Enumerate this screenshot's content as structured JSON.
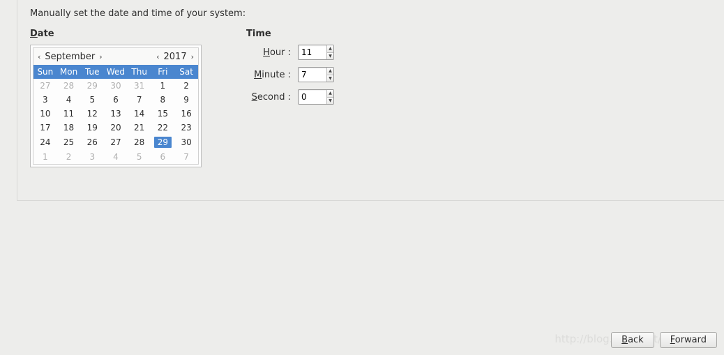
{
  "instruction": "Manually set the date and time of your system:",
  "date": {
    "title_prefix": "D",
    "title_rest": "ate",
    "month": "September",
    "year": "2017",
    "weekdays": [
      "Sun",
      "Mon",
      "Tue",
      "Wed",
      "Thu",
      "Fri",
      "Sat"
    ],
    "weeks": [
      [
        {
          "d": "27",
          "o": true
        },
        {
          "d": "28",
          "o": true
        },
        {
          "d": "29",
          "o": true
        },
        {
          "d": "30",
          "o": true
        },
        {
          "d": "31",
          "o": true
        },
        {
          "d": "1"
        },
        {
          "d": "2"
        }
      ],
      [
        {
          "d": "3"
        },
        {
          "d": "4"
        },
        {
          "d": "5"
        },
        {
          "d": "6"
        },
        {
          "d": "7"
        },
        {
          "d": "8"
        },
        {
          "d": "9"
        }
      ],
      [
        {
          "d": "10"
        },
        {
          "d": "11"
        },
        {
          "d": "12"
        },
        {
          "d": "13"
        },
        {
          "d": "14"
        },
        {
          "d": "15"
        },
        {
          "d": "16"
        }
      ],
      [
        {
          "d": "17"
        },
        {
          "d": "18"
        },
        {
          "d": "19"
        },
        {
          "d": "20"
        },
        {
          "d": "21"
        },
        {
          "d": "22"
        },
        {
          "d": "23"
        }
      ],
      [
        {
          "d": "24"
        },
        {
          "d": "25"
        },
        {
          "d": "26"
        },
        {
          "d": "27"
        },
        {
          "d": "28"
        },
        {
          "d": "29",
          "sel": true
        },
        {
          "d": "30"
        }
      ],
      [
        {
          "d": "1",
          "o": true
        },
        {
          "d": "2",
          "o": true
        },
        {
          "d": "3",
          "o": true
        },
        {
          "d": "4",
          "o": true
        },
        {
          "d": "5",
          "o": true
        },
        {
          "d": "6",
          "o": true
        },
        {
          "d": "7",
          "o": true
        }
      ]
    ]
  },
  "time": {
    "title": "Time",
    "hour_mn": "H",
    "hour_rest": "our :",
    "hour_value": "11",
    "minute_mn": "M",
    "minute_rest": "inute :",
    "minute_value": "7",
    "second_mn": "S",
    "second_rest": "econd :",
    "second_value": "0"
  },
  "buttons": {
    "back_mn": "B",
    "back_rest": "ack",
    "forward_mn": "F",
    "forward_rest": "orward"
  },
  "glyph": {
    "left": "‹",
    "right": "›",
    "up": "▲",
    "down": "▼"
  }
}
